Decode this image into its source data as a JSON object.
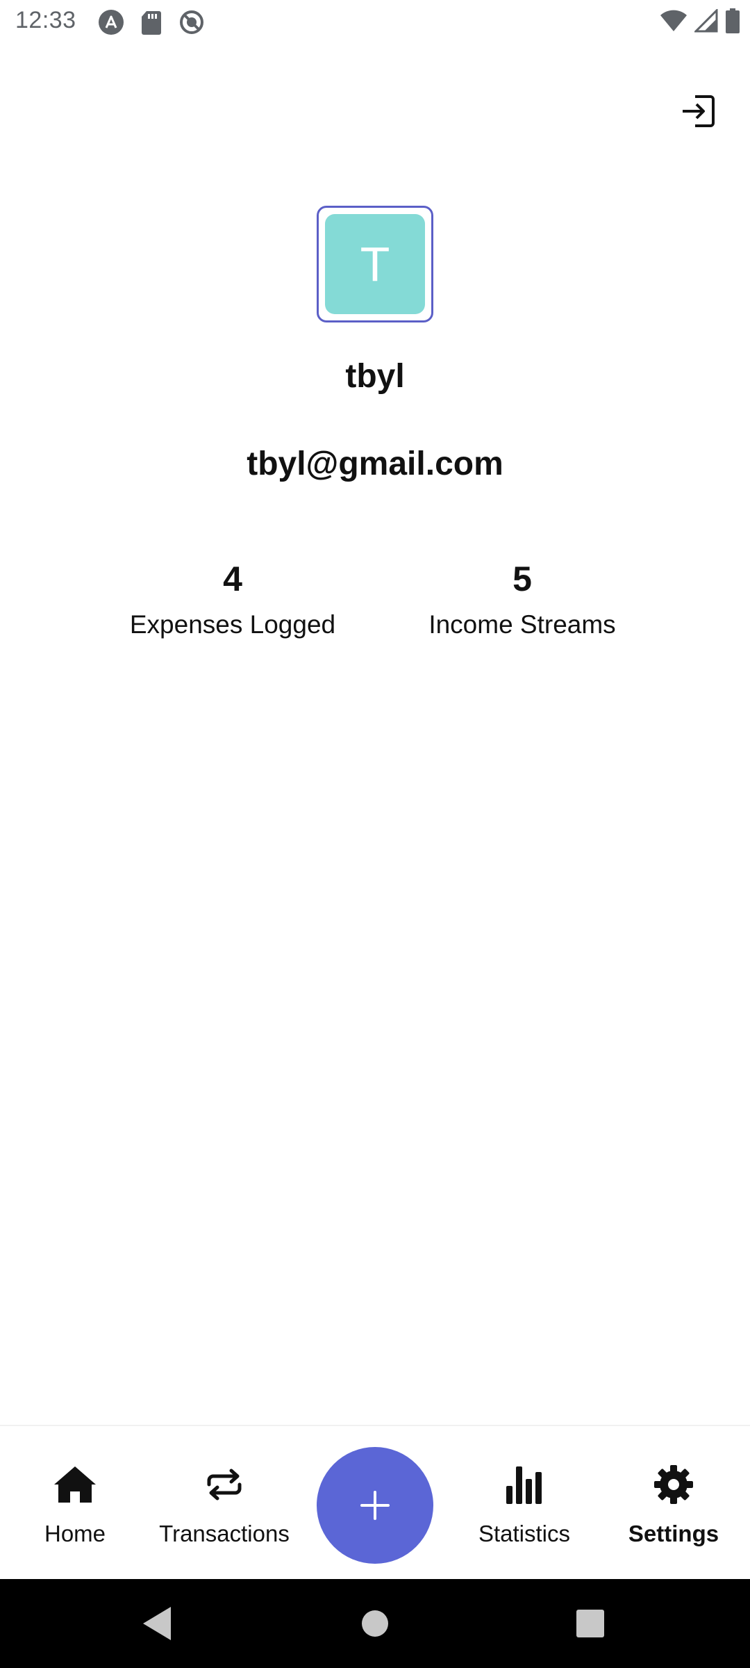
{
  "status_bar": {
    "time": "12:33",
    "left_icons": [
      "android-auto-icon",
      "sd-card-icon",
      "no-disturb-icon"
    ],
    "right_icons": [
      "wifi-icon",
      "cell-signal-icon",
      "battery-icon"
    ],
    "icon_color": "#5f6368"
  },
  "header": {
    "logout_icon": "logout-icon"
  },
  "profile": {
    "avatar_letter": "T",
    "avatar_color": "#84dad6",
    "avatar_border_color": "#5b5fc7",
    "username": "tbyl",
    "email": "tbyl@gmail.com"
  },
  "stats": {
    "expenses_count": "4",
    "expenses_label": "Expenses Logged",
    "income_count": "5",
    "income_label": "Income Streams"
  },
  "bottom_nav": {
    "items": [
      {
        "label": "Home",
        "icon": "home-icon",
        "active": false
      },
      {
        "label": "Transactions",
        "icon": "repeat-icon",
        "active": false
      },
      {
        "label": "Statistics",
        "icon": "bar-chart-icon",
        "active": false
      },
      {
        "label": "Settings",
        "icon": "gear-icon",
        "active": true
      }
    ],
    "fab_icon": "plus-icon",
    "fab_color": "#5b66d6"
  },
  "system_nav": {
    "buttons": [
      "back-icon",
      "home-circle-icon",
      "recents-icon"
    ]
  }
}
